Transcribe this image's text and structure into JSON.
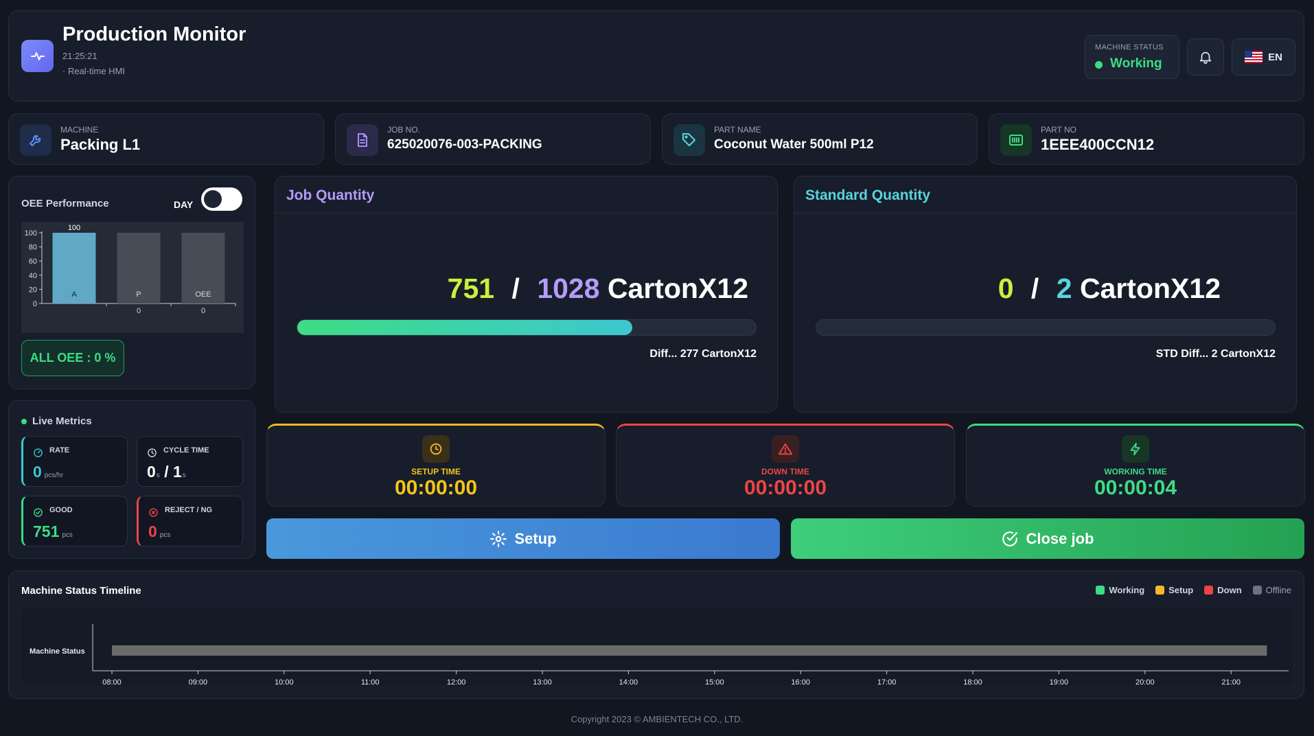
{
  "header": {
    "title": "Production Monitor",
    "clock": "21:25:21",
    "subtitle": "· Real-time HMI",
    "machine_status_label": "Machine Status",
    "machine_status_value": "Working",
    "language": "EN",
    "icons": {
      "logo": "activity-icon",
      "bell": "bell-icon",
      "flag": "us-flag-icon"
    }
  },
  "info_cards": [
    {
      "label": "Machine",
      "value": "Packing L1",
      "icon": "wrench-icon",
      "color": "#5b8ef0"
    },
    {
      "label": "Job No.",
      "value": "625020076-003-PACKING",
      "icon": "document-icon",
      "color": "#a78bfa"
    },
    {
      "label": "Part Name",
      "value": "Coconut Water 500ml P12",
      "icon": "tag-icon",
      "color": "#5bd3e0"
    },
    {
      "label": "Part No",
      "value": "1EEE400CCN12",
      "icon": "barcode-icon",
      "color": "#3ddc84"
    }
  ],
  "oee": {
    "title": "OEE Performance",
    "mode_label": "DAY",
    "all_oee_text": "ALL OEE : 0 %",
    "chart_data": {
      "type": "bar",
      "categories": [
        "A",
        "P",
        "OEE"
      ],
      "values": [
        100,
        0,
        0
      ],
      "ylim": [
        0,
        100
      ],
      "yticks": [
        0,
        20,
        40,
        60,
        80,
        100
      ],
      "title": "",
      "xlabel": "",
      "ylabel": "",
      "colors": {
        "bar": "#5fa8c6",
        "background": "#474d57"
      }
    }
  },
  "live_metrics": {
    "title": "Live Metrics",
    "rate": {
      "label": "Rate",
      "value": "0",
      "unit": "pcs/hr"
    },
    "cycle_time": {
      "label": "Cycle Time",
      "value_a": "0",
      "unit_a": "s",
      "sep": "/",
      "value_b": "1",
      "unit_b": "s"
    },
    "good": {
      "label": "Good",
      "value": "751",
      "unit": "pcs"
    },
    "reject": {
      "label": "Reject / NG",
      "value": "0",
      "unit": "pcs"
    }
  },
  "job_quantity": {
    "title": "Job Quantity",
    "current": "751",
    "separator": "/",
    "target": "1028",
    "unit": "CartonX12",
    "progress": 0.7305,
    "diff_text": "Diff... 277 CartonX12"
  },
  "standard_quantity": {
    "title": "Standard Quantity",
    "current": "0",
    "separator": "/",
    "target": "2",
    "unit": "CartonX12",
    "progress": 0,
    "diff_text": "STD Diff... 2 CartonX12"
  },
  "times": {
    "setup": {
      "label": "Setup Time",
      "value": "00:00:00",
      "color": "#f5c518",
      "icon": "clock-icon"
    },
    "down": {
      "label": "Down Time",
      "value": "00:00:00",
      "color": "#ef4444",
      "icon": "alert-triangle-icon"
    },
    "working": {
      "label": "Working Time",
      "value": "00:00:04",
      "color": "#3ddc84",
      "icon": "bolt-icon"
    }
  },
  "actions": {
    "setup_label": "Setup",
    "close_label": "Close job"
  },
  "timeline": {
    "title": "Machine Status Timeline",
    "row_label": "Machine Status",
    "legend": [
      {
        "name": "Working",
        "color": "#3ddc84"
      },
      {
        "name": "Setup",
        "color": "#f5b829"
      },
      {
        "name": "Down",
        "color": "#ef4444"
      },
      {
        "name": "Offline",
        "color": "#6b7280"
      }
    ],
    "hours": [
      "08:00",
      "09:00",
      "10:00",
      "11:00",
      "12:00",
      "13:00",
      "14:00",
      "15:00",
      "16:00",
      "17:00",
      "18:00",
      "19:00",
      "20:00",
      "21:00"
    ],
    "segment": {
      "status": "Offline",
      "start": "08:00",
      "end": "21:25",
      "color": "#6b6b6b"
    }
  },
  "footer": "Copyright 2023 © AMBIENTECH CO., LTD."
}
